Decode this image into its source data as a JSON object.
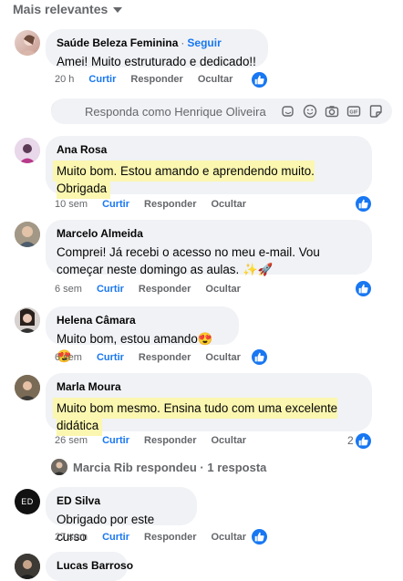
{
  "sort_label": "Mais relevantes",
  "reply_box": {
    "placeholder": "Responda como Henrique Oliveira"
  },
  "comments": [
    {
      "author": "Saúde Beleza Feminina",
      "follow": "Seguir",
      "text": "Amei! Muito estruturado e dedicado!!",
      "time": "20 h",
      "like": "Curtir",
      "reply": "Responder",
      "hide": "Ocultar",
      "highlighted": false
    },
    {
      "author": "Ana Rosa",
      "text": "Muito bom. Estou amando e aprendendo muito. Obrigada",
      "time": "10 sem",
      "like": "Curtir",
      "reply": "Responder",
      "hide": "Ocultar",
      "highlighted": true
    },
    {
      "author": "Marcelo Almeida",
      "text": "Comprei! Já recebi o acesso no meu e-mail. Vou começar neste domingo as aulas. ✨🚀",
      "time": "6 sem",
      "like": "Curtir",
      "reply": "Responder",
      "hide": "Ocultar",
      "highlighted": false
    },
    {
      "author": "Helena Câmara",
      "text": "Muito bom, estou amando😍😍",
      "time": "6 sem",
      "like": "Curtir",
      "reply": "Responder",
      "hide": "Ocultar",
      "highlighted": false
    },
    {
      "author": "Marla Moura",
      "text": "Muito bom mesmo. Ensina tudo com uma excelente didática",
      "time": "26 sem",
      "like": "Curtir",
      "reply": "Responder",
      "hide": "Ocultar",
      "likes": "2",
      "highlighted": true
    },
    {
      "author": "ED Silva",
      "text": "Obrigado por este curso",
      "time": "27 sem",
      "like": "Curtir",
      "reply": "Responder",
      "hide": "Ocultar",
      "highlighted": false
    },
    {
      "author": "Lucas Barroso"
    }
  ],
  "replies_summary": "Marcia Rib respondeu · 1 resposta",
  "avatar_ed_text": "ED",
  "colors": {
    "accent": "#1877f2",
    "bubble": "#f0f2f5",
    "highlight": "#fbf7b0",
    "muted": "#65676b"
  }
}
